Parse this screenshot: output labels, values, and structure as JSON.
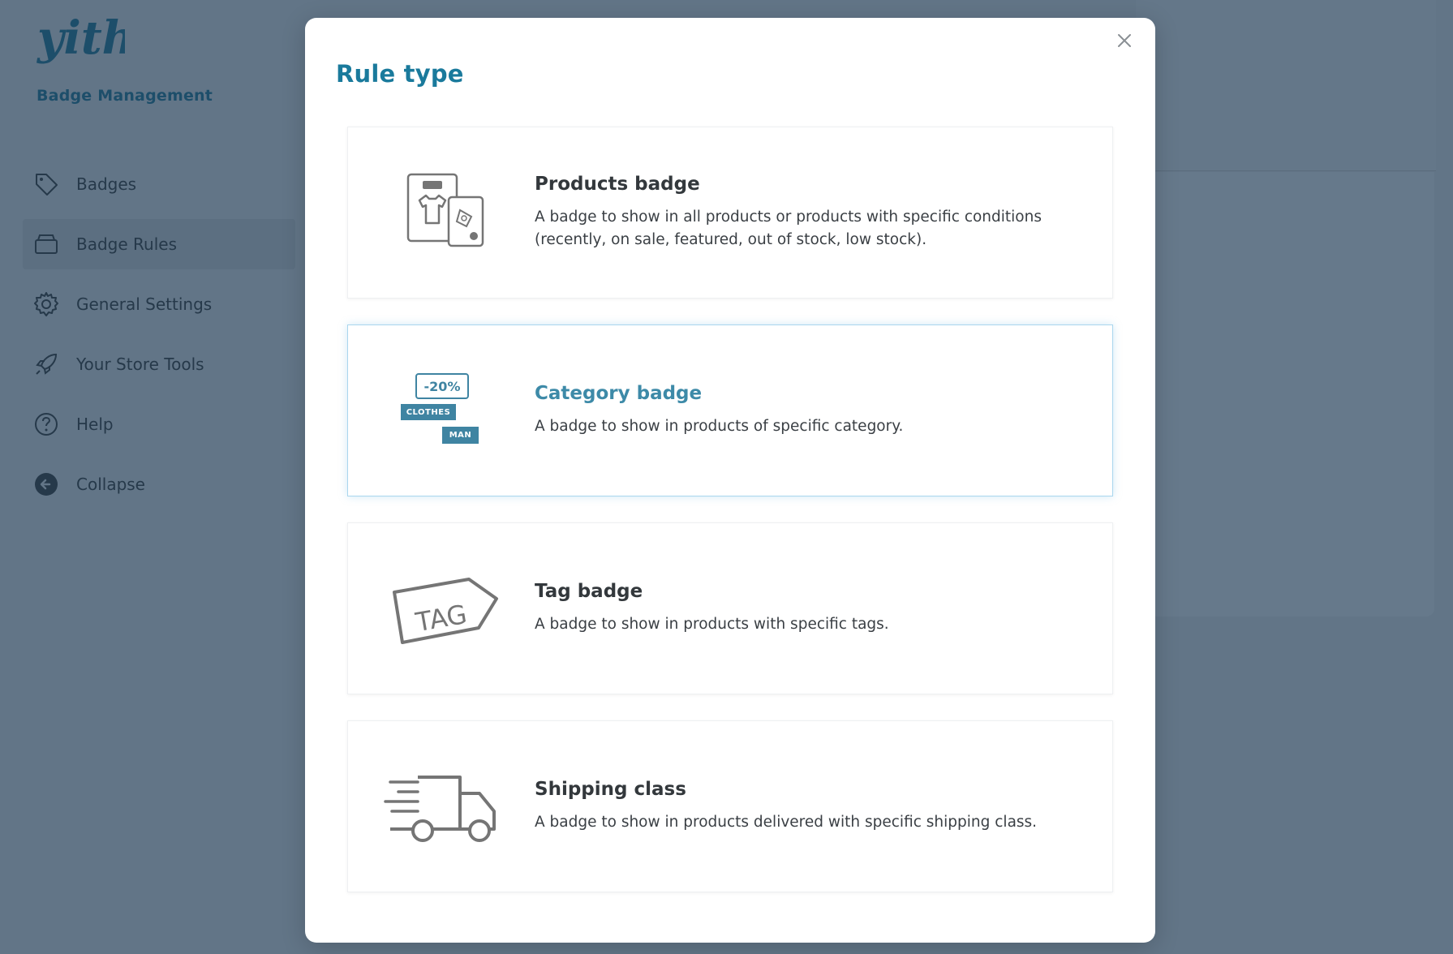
{
  "app": {
    "brand_title": "Badge Management",
    "logo_icon": "yith-logo",
    "sidebar": {
      "items": [
        {
          "label": "Badges",
          "icon": "tag-icon",
          "active": false
        },
        {
          "label": "Badge Rules",
          "icon": "box-icon",
          "active": true
        },
        {
          "label": "General Settings",
          "icon": "gear-icon",
          "active": false
        },
        {
          "label": "Your Store Tools",
          "icon": "rocket-icon",
          "active": false
        },
        {
          "label": "Help",
          "icon": "help-icon",
          "active": false
        },
        {
          "label": "Collapse",
          "icon": "collapse-arrow-icon",
          "active": false
        }
      ]
    }
  },
  "modal": {
    "title": "Rule type",
    "close_icon": "close-icon",
    "options": [
      {
        "title": "Products badge",
        "description": "A badge to show in all products or products with specific conditions (recently, on sale, featured, out of stock, low stock).",
        "icon": "products-badge-icon",
        "selected": false
      },
      {
        "title": "Category badge",
        "description": "A badge to show in products of specific category.",
        "icon": "category-badge-icon",
        "selected": true,
        "illustration_labels": {
          "discount": "-20%",
          "tag1": "CLOTHES",
          "tag2": "MAN"
        }
      },
      {
        "title": "Tag badge",
        "description": "A badge to show in products with specific tags.",
        "icon": "tag-badge-icon",
        "selected": false,
        "illustration_labels": {
          "tag": "TAG"
        }
      },
      {
        "title": "Shipping class",
        "description": "A badge to show in products delivered with specific shipping class.",
        "icon": "truck-icon",
        "selected": false
      }
    ]
  },
  "colors": {
    "accent": "#1a7a9c",
    "selected_title": "#3d8aa8",
    "badge_blue": "#3f84a2",
    "overlay_bg": "#627587"
  }
}
